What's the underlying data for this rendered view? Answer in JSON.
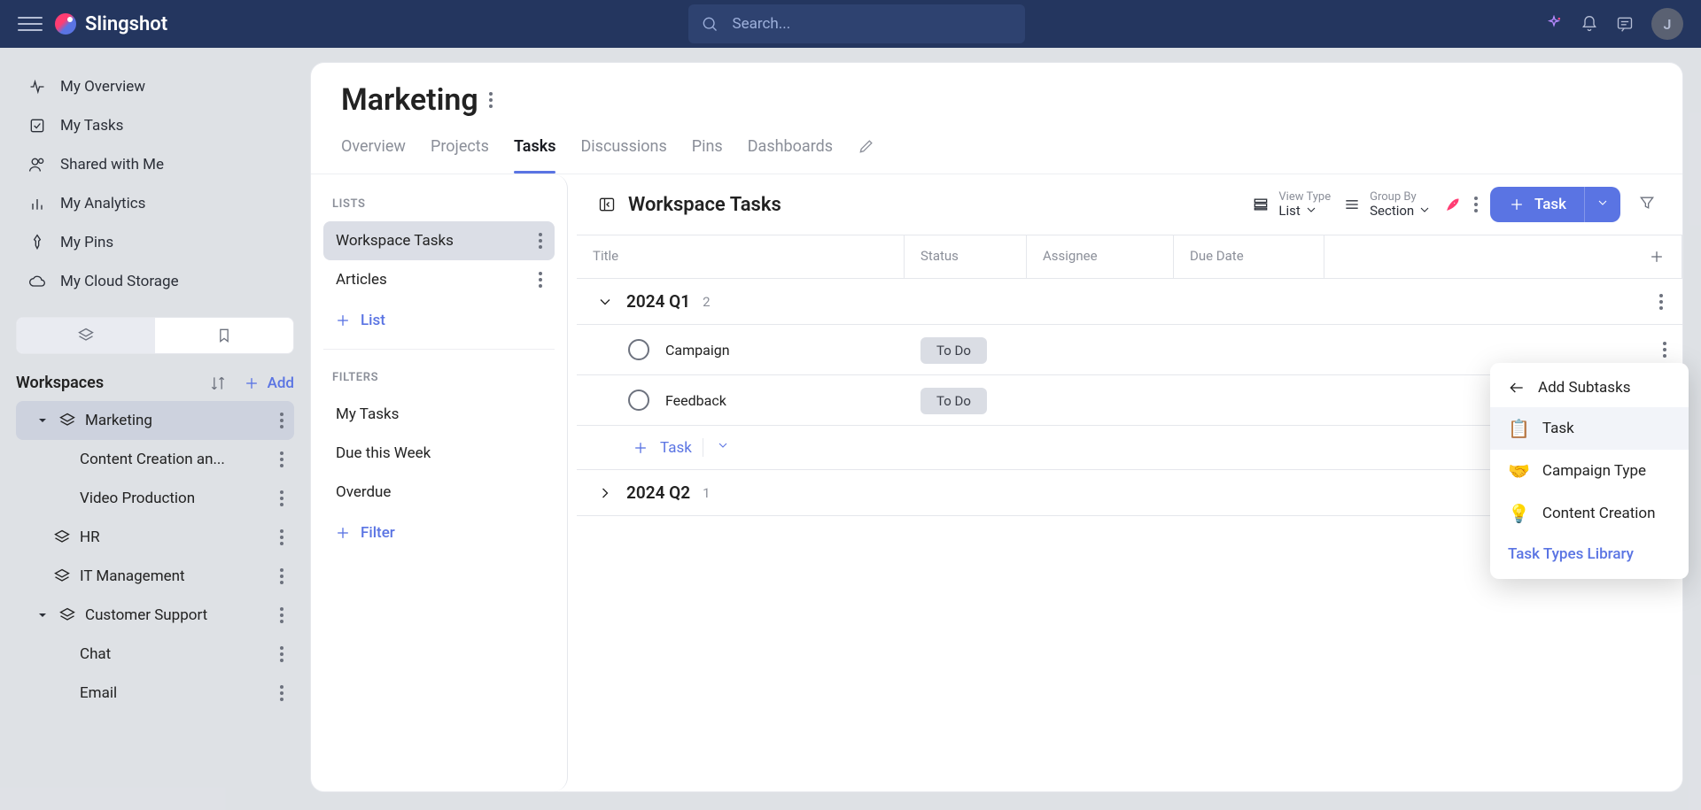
{
  "brand": "Slingshot",
  "search_placeholder": "Search...",
  "avatar_initial": "J",
  "left_nav": [
    {
      "label": "My Overview"
    },
    {
      "label": "My Tasks"
    },
    {
      "label": "Shared with Me"
    },
    {
      "label": "My Analytics"
    },
    {
      "label": "My Pins"
    },
    {
      "label": "My Cloud Storage"
    }
  ],
  "workspaces_label": "Workspaces",
  "add_label": "Add",
  "tree": [
    {
      "label": "Marketing",
      "selected": true,
      "children": [
        {
          "label": "Content Creation an..."
        },
        {
          "label": "Video Production"
        }
      ]
    },
    {
      "label": "HR"
    },
    {
      "label": "IT Management"
    },
    {
      "label": "Customer Support",
      "children": [
        {
          "label": "Chat"
        },
        {
          "label": "Email"
        }
      ]
    }
  ],
  "page_title": "Marketing",
  "tabs": [
    "Overview",
    "Projects",
    "Tasks",
    "Discussions",
    "Pins",
    "Dashboards"
  ],
  "active_tab": "Tasks",
  "lists_label": "LISTS",
  "lists": [
    {
      "label": "Workspace Tasks",
      "active": true
    },
    {
      "label": "Articles"
    }
  ],
  "add_list": "List",
  "filters_label": "FILTERS",
  "filters": [
    "My Tasks",
    "Due this Week",
    "Overdue"
  ],
  "add_filter": "Filter",
  "task_panel": {
    "title": "Workspace Tasks",
    "view_type_label": "View Type",
    "view_type_value": "List",
    "group_by_label": "Group By",
    "group_by_value": "Section",
    "task_button": "Task",
    "columns": [
      "Title",
      "Status",
      "Assignee",
      "Due Date"
    ],
    "sections": [
      {
        "name": "2024 Q1",
        "count": "2",
        "expanded": true,
        "tasks": [
          {
            "title": "Campaign",
            "status": "To Do"
          },
          {
            "title": "Feedback",
            "status": "To Do"
          }
        ]
      },
      {
        "name": "2024 Q2",
        "count": "1",
        "expanded": false
      }
    ],
    "add_task": "Task"
  },
  "popover": {
    "header": "Add Subtasks",
    "items": [
      "Task",
      "Campaign Type",
      "Content Creation"
    ],
    "link": "Task Types Library"
  }
}
